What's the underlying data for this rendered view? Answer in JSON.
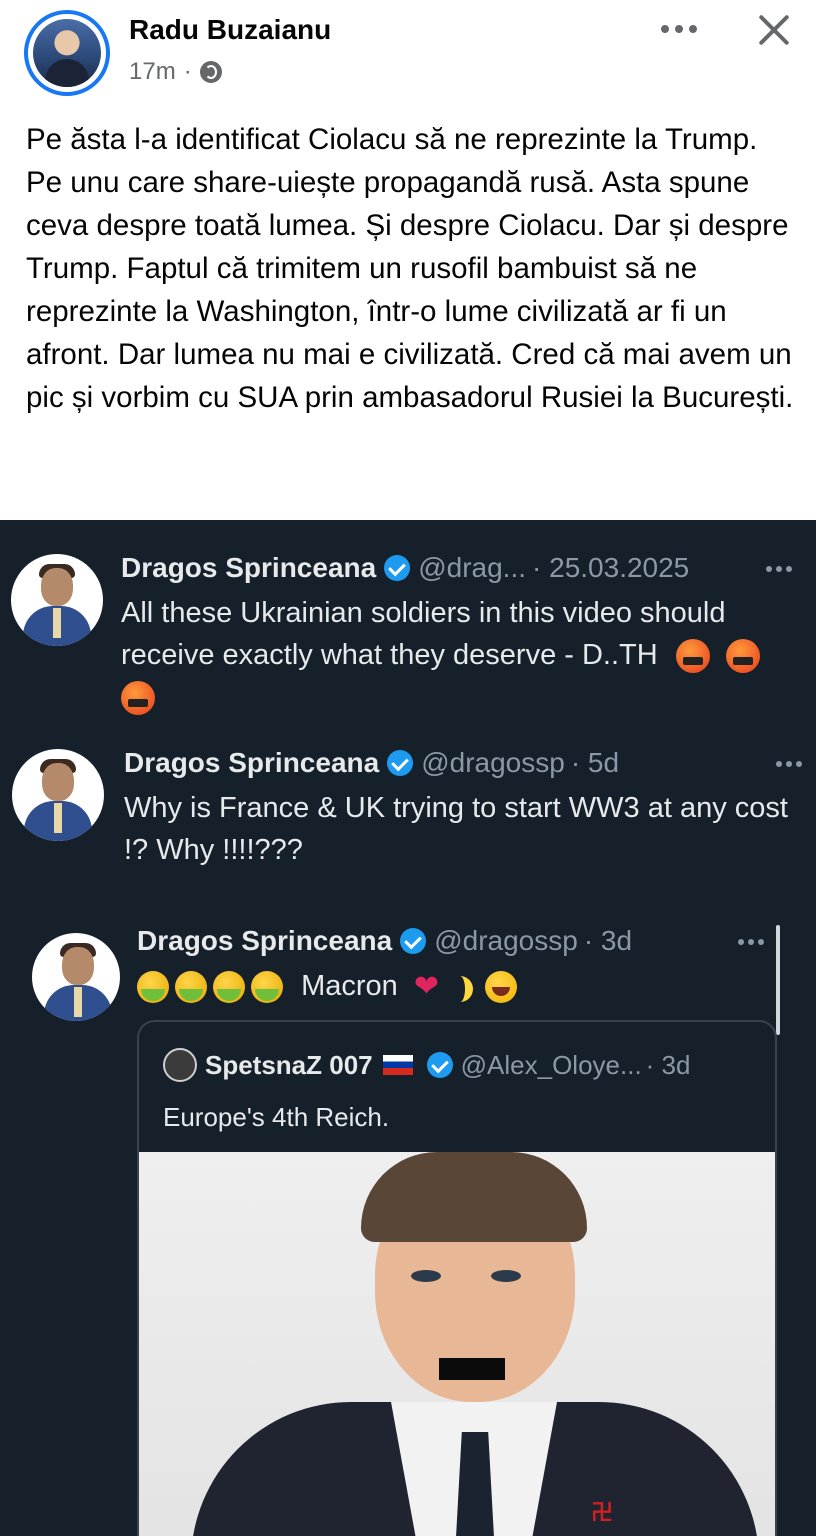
{
  "post": {
    "author": "Radu Buzaianu",
    "time": "17m",
    "separator": "·",
    "text": "Pe ăsta l-a identificat Ciolacu să ne reprezinte la Trump. Pe unu care share-uiește propagandă rusă. Asta spune ceva despre toată lumea. Și despre Ciolacu. Dar și despre Trump. Faptul că trimitem un rusofil bambuist să ne reprezinte la Washington, într-o lume civilizată ar fi un afront. Dar lumea nu mai e civilizată. Cred că mai avem un pic și vorbim cu SUA prin ambasadorul Rusiei la București.",
    "icons": {
      "privacy": "globe-icon",
      "menu": "more-icon",
      "close": "close-icon"
    }
  },
  "embed": {
    "tweets": [
      {
        "name": "Dragos Sprinceana",
        "handle": "@drag...",
        "meta": "· 25.03.2025",
        "text": "All these Ukrainian soldiers in this video should receive exactly what they deserve - D..TH",
        "emojis": [
          "angry-face-icon",
          "angry-face-icon",
          "angry-face-icon"
        ]
      },
      {
        "name": "Dragos Sprinceana",
        "handle": "@dragossp",
        "meta": "· 5d",
        "text": "Why is France & UK trying to start WW3 at any cost !? Why !!!!???"
      },
      {
        "name": "Dragos Sprinceana",
        "handle": "@dragossp",
        "meta": "· 3d",
        "text": "Macron",
        "emojis_before": [
          "nauseated-face-icon",
          "nauseated-face-icon",
          "nauseated-face-icon",
          "nauseated-face-icon"
        ],
        "emojis_after": [
          "heart-icon",
          "banana-icon",
          "laughing-face-icon"
        ]
      }
    ],
    "quote": {
      "name": "SpetsnaZ 007",
      "handle": "@Alex_Oloye...",
      "meta": "· 3d",
      "text": "Europe's 4th Reich."
    }
  },
  "colors": {
    "facebook_blue": "#1877f2",
    "x_dark_bg": "#15202b",
    "verified_blue": "#1d9bf0"
  }
}
